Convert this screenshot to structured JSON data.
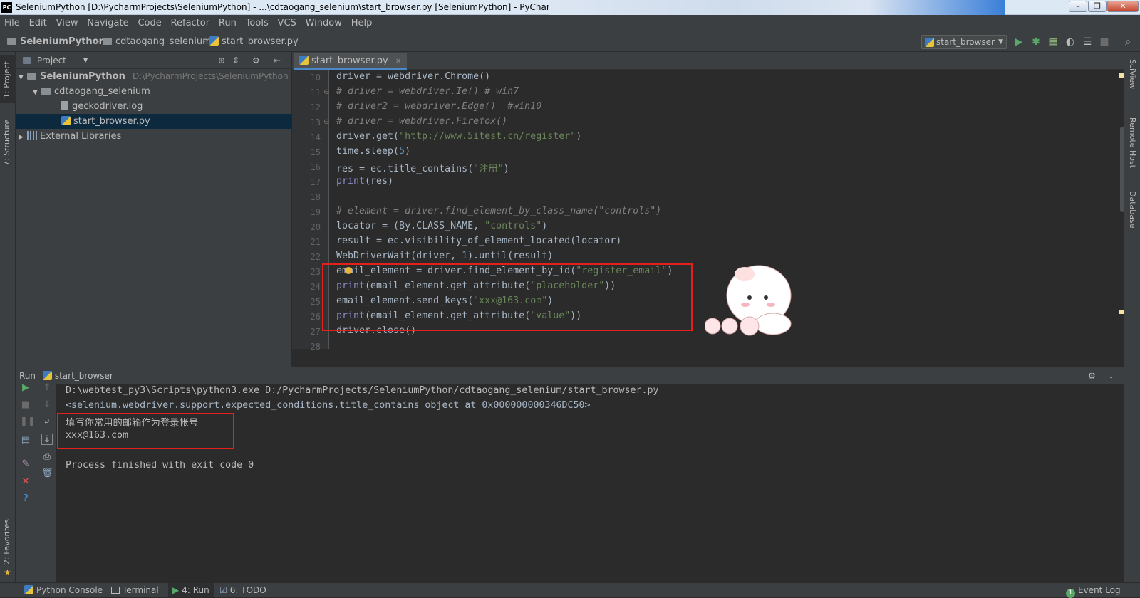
{
  "window": {
    "title": "SeleniumPython [D:\\PycharmProjects\\SeleniumPython] - ...\\cdtaogang_selenium\\start_browser.py [SeleniumPython] - PyCharm",
    "app_icon": "PC"
  },
  "menu": [
    "File",
    "Edit",
    "View",
    "Navigate",
    "Code",
    "Refactor",
    "Run",
    "Tools",
    "VCS",
    "Window",
    "Help"
  ],
  "breadcrumb": {
    "project": "SeleniumPython",
    "folder": "cdtaogang_selenium",
    "file": "start_browser.py"
  },
  "run_config": "start_browser",
  "left_tabs": {
    "project": "1: Project",
    "structure": "7: Structure",
    "favorites": "2: Favorites"
  },
  "right_tabs": {
    "sciview": "SciView",
    "remote": "Remote Host",
    "database": "Database"
  },
  "project_panel": {
    "header": "Project",
    "tree": [
      {
        "label": "SeleniumPython",
        "path": "D:\\PycharmProjects\\SeleniumPython"
      },
      {
        "label": "cdtaogang_selenium"
      },
      {
        "label": "geckodriver.log"
      },
      {
        "label": "start_browser.py"
      },
      {
        "label": "External Libraries"
      }
    ]
  },
  "editor": {
    "tab": "start_browser.py",
    "line_numbers": [
      "10",
      "11",
      "12",
      "13",
      "14",
      "15",
      "16",
      "17",
      "18",
      "19",
      "20",
      "21",
      "22",
      "23",
      "24",
      "25",
      "26",
      "27",
      "28"
    ]
  },
  "run_panel": {
    "title": "Run",
    "config": "start_browser",
    "lines": [
      "D:\\webtest_py3\\Scripts\\python3.exe D:/PycharmProjects/SeleniumPython/cdtaogang_selenium/start_browser.py",
      "<selenium.webdriver.support.expected_conditions.title_contains object at 0x000000000346DC50>",
      "填写你常用的邮箱作为登录帐号",
      "xxx@163.com",
      "",
      "Process finished with exit code 0"
    ]
  },
  "status_bar": {
    "python_console": "Python Console",
    "terminal": "Terminal",
    "run": "4: Run",
    "todo": "6: TODO",
    "event_log": "Event Log"
  },
  "colors": {
    "highlight_box": "#e3201b",
    "accent": "#4a88c7",
    "run_green": "#59a869"
  }
}
